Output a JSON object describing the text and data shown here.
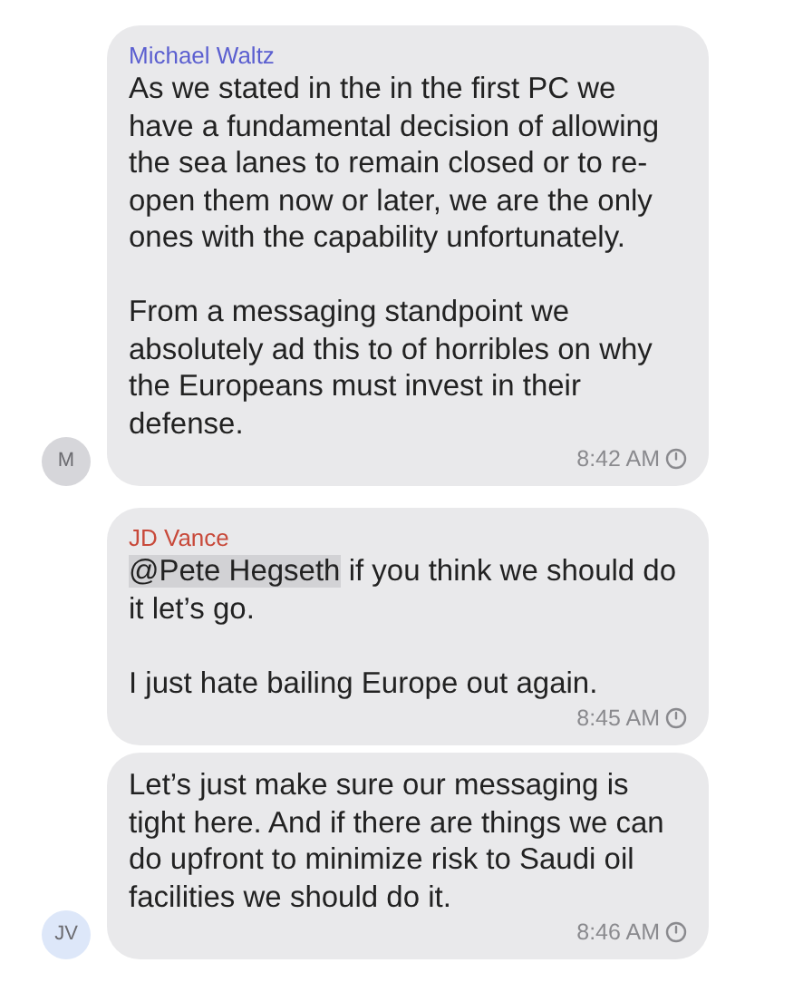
{
  "messages": [
    {
      "sender": {
        "name": "Michael Waltz",
        "color": "#5b5fd0"
      },
      "paragraphs": [
        {
          "text": "As we stated in the in the first PC we have a fundamental decision of allowing the sea lanes to remain closed or to re-open them now or later, we are the only ones with the capability unfortunately."
        },
        {
          "text": "From a messaging standpoint we absolutely ad this to of horribles on why the Europeans must invest in their defense."
        }
      ],
      "time": "8:42 AM",
      "avatar": {
        "initials": "M",
        "color": "#d6d6da"
      }
    },
    {
      "sender": {
        "name": "JD Vance",
        "color": "#c8493a"
      },
      "paragraphs": [
        {
          "mention": "@Pete Hegseth",
          "text": "if you think we should do it let’s go."
        },
        {
          "text": "I just hate bailing Europe out again."
        }
      ],
      "time": "8:45 AM"
    },
    {
      "paragraphs": [
        {
          "text": "Let’s just make sure our messaging is tight here. And if there are things we can do upfront to minimize risk to Saudi oil facilities we should do it."
        }
      ],
      "time": "8:46 AM",
      "avatar": {
        "initials": "JV",
        "color": "#dde7f9"
      }
    }
  ]
}
